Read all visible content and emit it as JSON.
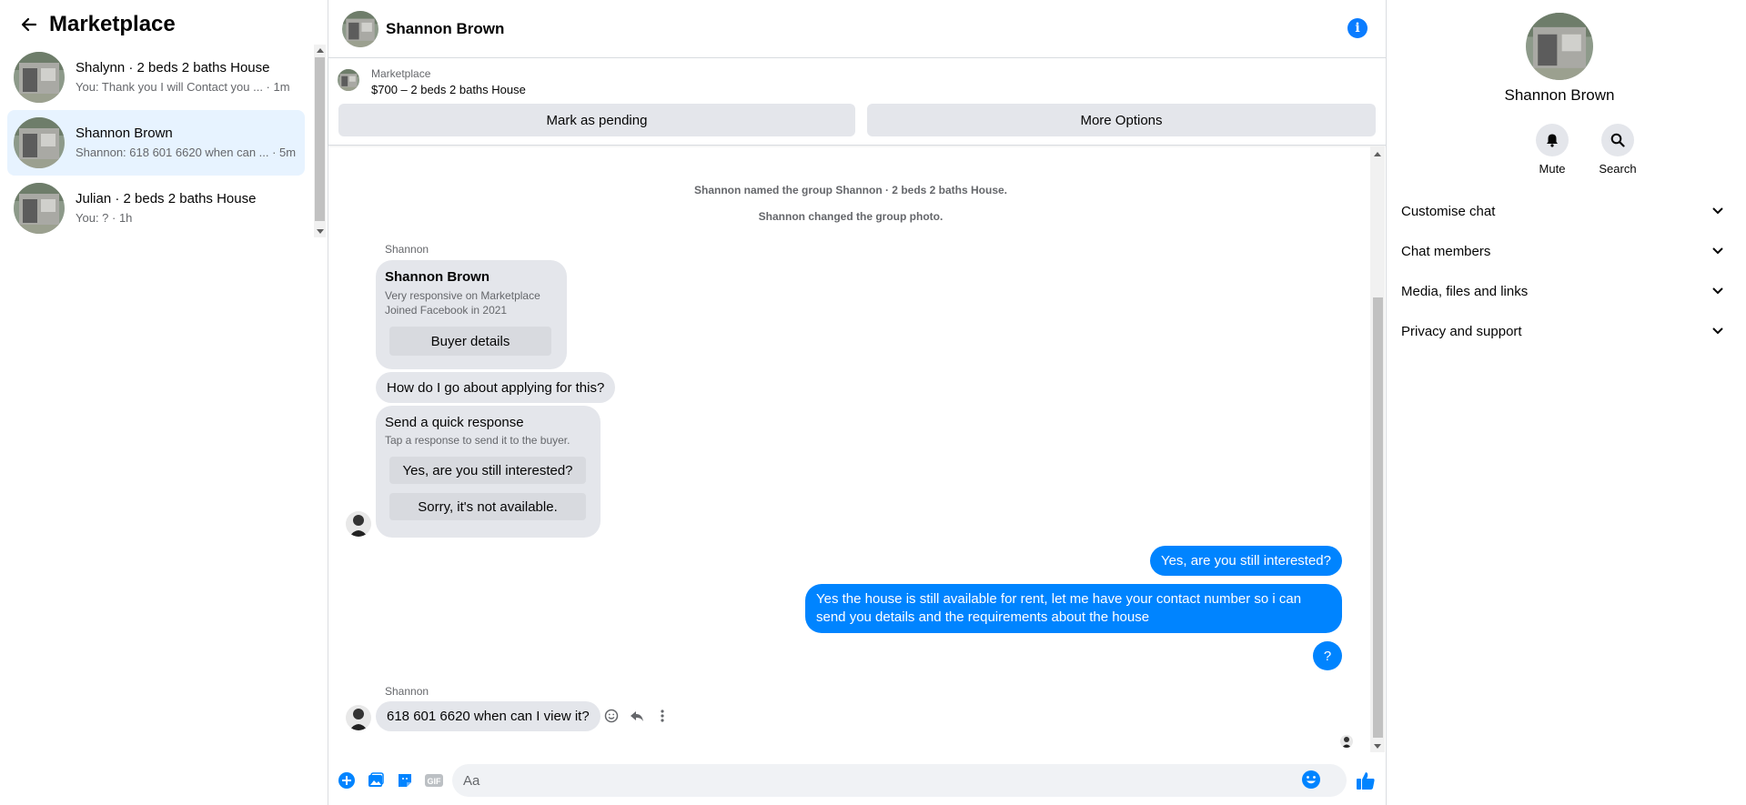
{
  "left": {
    "title": "Marketplace",
    "conversations": [
      {
        "name": "Shalynn · 2 beds 2 baths House",
        "preview": "You: Thank you I will Contact you ... · 1m"
      },
      {
        "name": "Shannon Brown",
        "preview": "Shannon: 618 601 6620 when can ... · 5m"
      },
      {
        "name": "Julian · 2 beds 2 baths House",
        "preview": "You: ? · 1h"
      }
    ]
  },
  "header": {
    "title": "Shannon Brown"
  },
  "listing": {
    "source": "Marketplace",
    "title": "$700 – 2 beds 2 baths House",
    "pending_label": "Mark as pending",
    "options_label": "More Options"
  },
  "messages": {
    "sys1": "Shannon named the group Shannon · 2 beds 2 baths House.",
    "sys2": "Shannon changed the group photo.",
    "sender1": "Shannon",
    "card_name": "Shannon Brown",
    "card_line1": "Very responsive on Marketplace",
    "card_line2": "Joined Facebook in 2021",
    "card_button": "Buyer details",
    "msg1": "How do I go about applying for this?",
    "quick_title": "Send a quick response",
    "quick_sub": "Tap a response to send it to the buyer.",
    "quick_opt1": "Yes, are you still interested?",
    "quick_opt2": "Sorry, it's not available.",
    "out1": "Yes, are you still interested?",
    "out2": "Yes the house is still available for rent, let me have your contact number so i can send you details and the requirements about the house",
    "out3": "?",
    "sender2": "Shannon",
    "msg2": "618 601 6620 when can I view it?"
  },
  "composer": {
    "placeholder": "Aa"
  },
  "right": {
    "name": "Shannon Brown",
    "mute_label": "Mute",
    "search_label": "Search",
    "sections": [
      "Customise chat",
      "Chat members",
      "Media, files and links",
      "Privacy and support"
    ]
  },
  "colors": {
    "accent": "#0084ff",
    "active_bg": "#e7f3ff",
    "bubble_in": "#e4e6eb"
  }
}
